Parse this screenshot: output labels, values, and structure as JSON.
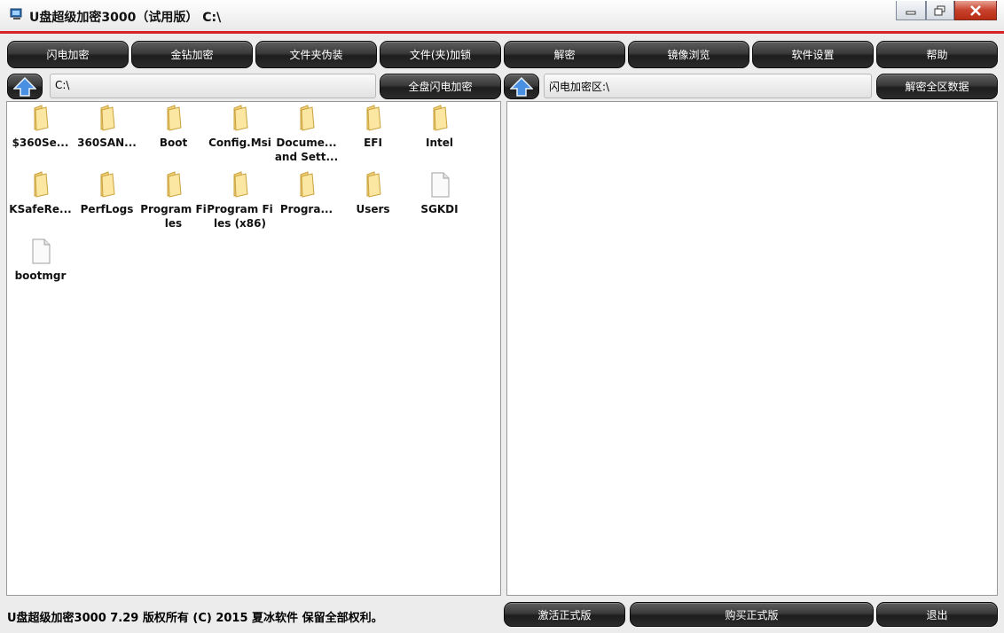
{
  "window": {
    "title": "U盘超级加密3000（试用版） C:\\"
  },
  "toolbar": {
    "tabs": [
      "闪电加密",
      "金钻加密",
      "文件夹伪装",
      "文件(夹)加锁",
      "解密",
      "镜像浏览",
      "软件设置",
      "帮助"
    ]
  },
  "left_pane": {
    "path": "C:\\",
    "action_button": "全盘闪电加密",
    "items": [
      {
        "label": "$360Se...",
        "type": "folder"
      },
      {
        "label": "360SAN...",
        "type": "folder"
      },
      {
        "label": "Boot",
        "type": "folder"
      },
      {
        "label": "Config.Msi",
        "type": "folder"
      },
      {
        "label": "Docume... and Sett...",
        "type": "folder"
      },
      {
        "label": "EFI",
        "type": "folder"
      },
      {
        "label": "Intel",
        "type": "folder"
      },
      {
        "label": "KSafeRe...",
        "type": "folder"
      },
      {
        "label": "PerfLogs",
        "type": "folder"
      },
      {
        "label": "Program Files",
        "type": "folder"
      },
      {
        "label": "Program Files (x86)",
        "type": "folder"
      },
      {
        "label": "Progra...",
        "type": "folder"
      },
      {
        "label": "Users",
        "type": "folder"
      },
      {
        "label": "SGKDI",
        "type": "file"
      },
      {
        "label": "bootmgr",
        "type": "file"
      }
    ]
  },
  "right_pane": {
    "path": "闪电加密区:\\",
    "action_button": "解密全区数据"
  },
  "footer": {
    "copyright": "U盘超级加密3000  7.29 版权所有 (C) 2015 夏冰软件 保留全部权利。",
    "activate": "激活正式版",
    "buy": "购买正式版",
    "exit": "退出"
  }
}
